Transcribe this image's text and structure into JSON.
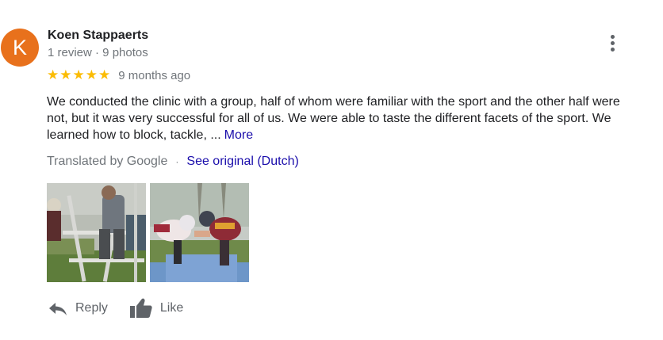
{
  "reviewer": {
    "initial": "K",
    "name": "Koen Stappaerts",
    "meta": "1 review · 9 photos",
    "avatar_color": "#e8711c"
  },
  "rating": {
    "stars": 5,
    "star_glyph": "★",
    "star_color": "#fbbc04",
    "time": "9 months ago"
  },
  "review": {
    "text": "We conducted the clinic with a group, half of whom were familiar with the sport and the other half were not, but it was very successful for all of us. We were able to taste the different facets of the sport. We learned how to block, tackle, ...",
    "more_label": "More"
  },
  "translation": {
    "label": "Translated by Google",
    "separator": "·",
    "see_original": "See original (Dutch)"
  },
  "photos": [
    {
      "icon": "photo-football-training"
    },
    {
      "icon": "photo-football-tackle"
    }
  ],
  "actions": {
    "reply_label": "Reply",
    "like_label": "Like"
  },
  "colors": {
    "link": "#1a0dab",
    "secondary_text": "#70757a",
    "icon": "#5f6368"
  }
}
